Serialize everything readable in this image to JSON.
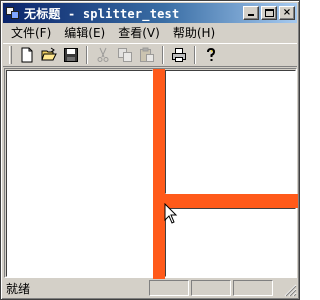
{
  "window": {
    "title": "无标题 - splitter_test",
    "buttons": {
      "minimize": "_",
      "maximize": "□",
      "close": "×"
    }
  },
  "menu": {
    "items": [
      "文件(F)",
      "编辑(E)",
      "查看(V)",
      "帮助(H)"
    ]
  },
  "toolbar": {
    "buttons": [
      {
        "icon": "new-document-icon",
        "enabled": true
      },
      {
        "icon": "open-folder-icon",
        "enabled": true
      },
      {
        "icon": "save-disk-icon",
        "enabled": true
      },
      {
        "icon": "cut-icon",
        "enabled": false
      },
      {
        "icon": "copy-icon",
        "enabled": false
      },
      {
        "icon": "paste-icon",
        "enabled": false
      },
      {
        "icon": "print-icon",
        "enabled": true
      },
      {
        "icon": "help-icon",
        "enabled": true
      }
    ]
  },
  "splitter": {
    "color": "#ff5a1a"
  },
  "status": {
    "text": "就绪"
  }
}
